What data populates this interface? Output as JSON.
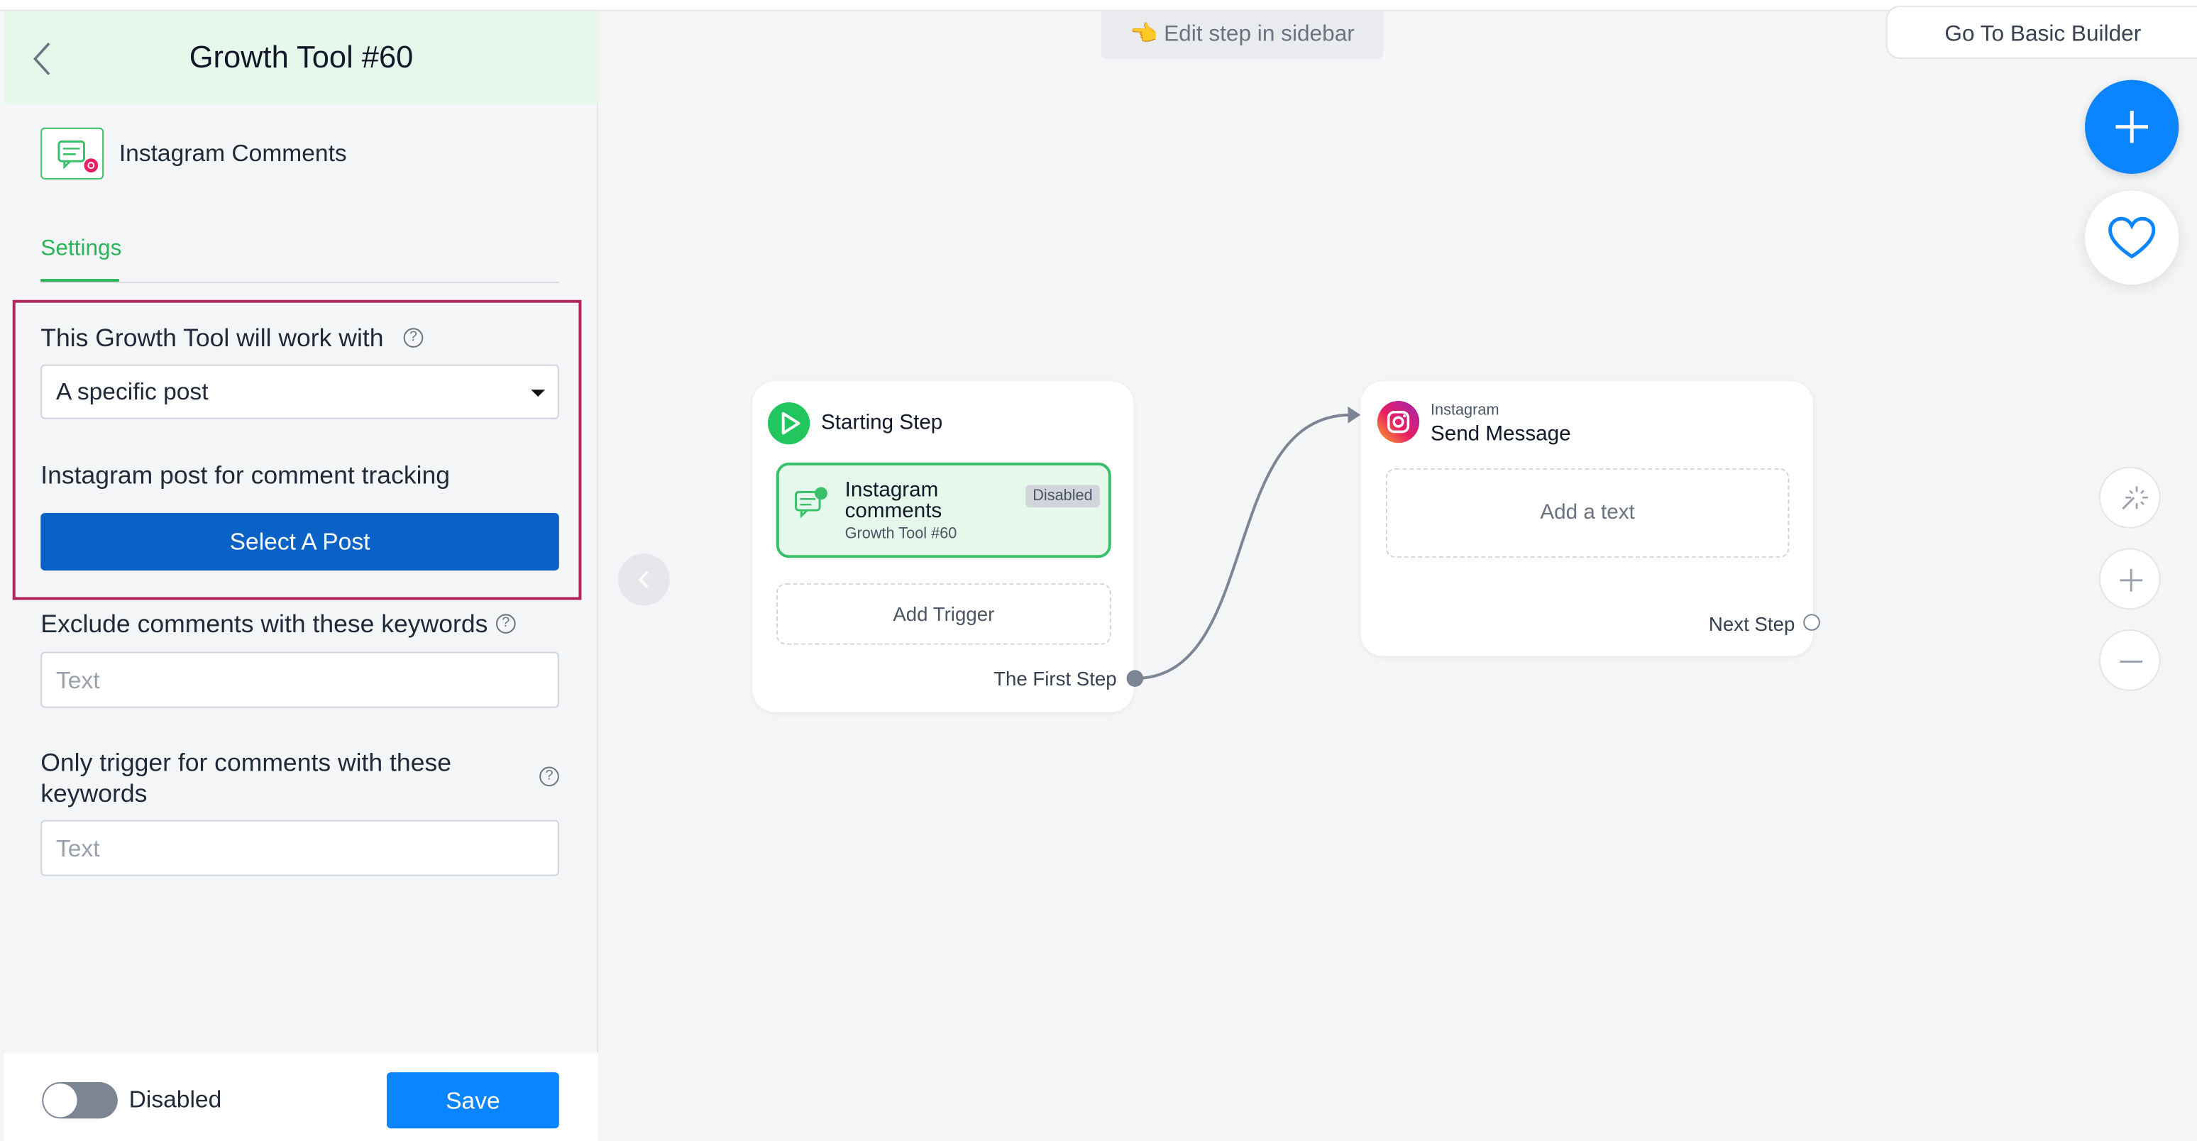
{
  "sidebar": {
    "title": "Growth Tool #60",
    "tool_name": "Instagram Comments",
    "tab_settings": "Settings",
    "work_with_label": "This Growth Tool will work with",
    "work_with_value": "A specific post",
    "post_label": "Instagram post for comment tracking",
    "select_post_button": "Select A Post",
    "exclude_label": "Exclude comments with these keywords",
    "exclude_placeholder": "Text",
    "only_trigger_label": "Only trigger for comments with these keywords",
    "only_trigger_placeholder": "Text",
    "toggle_label": "Disabled",
    "toggle_on": false,
    "save_button": "Save"
  },
  "canvas": {
    "hint_icon": "👈",
    "hint_text": "Edit step in sidebar",
    "basic_builder_button": "Go To Basic Builder",
    "start_node": {
      "title": "Starting Step",
      "trigger_name": "Instagram comments",
      "trigger_sub": "Growth Tool #60",
      "trigger_badge": "Disabled",
      "add_trigger": "Add Trigger",
      "output_label": "The First Step"
    },
    "message_node": {
      "channel": "Instagram",
      "title": "Send Message",
      "add_text": "Add a text",
      "output_label": "Next Step"
    }
  },
  "colors": {
    "accent_green": "#2ab55a",
    "primary_blue": "#0a62c7",
    "fab_blue": "#0a84ff",
    "highlight": "#b3245c"
  },
  "icons": [
    "back-icon",
    "instagram-comments-icon",
    "help-icon",
    "caret-down-icon",
    "plus-icon",
    "heart-icon",
    "magic-wand-icon",
    "zoom-in-icon",
    "zoom-out-icon",
    "chevron-left-icon",
    "play-icon",
    "chat-icon",
    "instagram-icon"
  ]
}
